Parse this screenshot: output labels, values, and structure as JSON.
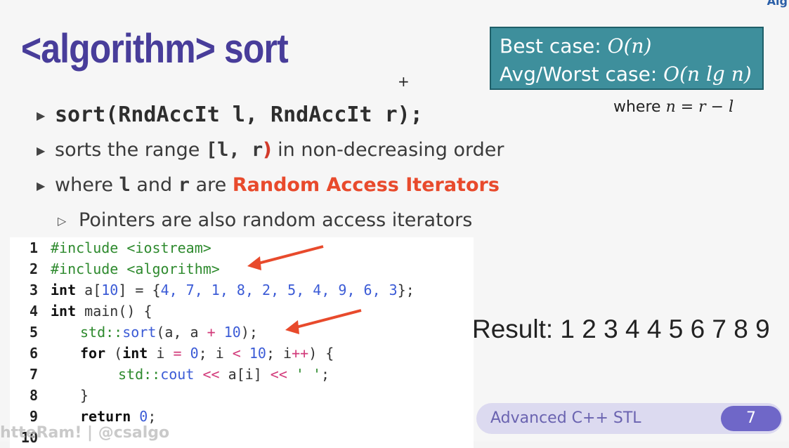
{
  "corner_text": "Alg",
  "title": "<algorithm> sort",
  "complexity": {
    "best_label": "Best case: ",
    "best_value": "O(n)",
    "avg_label": "Avg/Worst case: ",
    "avg_value": "O(n lg n)"
  },
  "where_note": {
    "prefix": "where ",
    "formula": "n = r − l"
  },
  "bullets": {
    "b1": "sort(RndAccIt l, RndAccIt r);",
    "b2_pre": "sorts the range ",
    "b2_open": "[",
    "b2_code": "l, r",
    "b2_close": ")",
    "b2_post": " in non-decreasing order",
    "b3_pre": "where ",
    "b3_l": "l",
    "b3_and": " and ",
    "b3_r": "r",
    "b3_are": " are ",
    "b3_highlight": "Random Access Iterators",
    "b4": "Pointers are also random access iterators"
  },
  "code": {
    "l1": {
      "n": "1",
      "a": "#include <iostream>"
    },
    "l2": {
      "n": "2",
      "a": "#include <algorithm>"
    },
    "l3": {
      "n": "3",
      "kw": "int",
      "v": " a[",
      "n10": "10",
      "rest": "] = {",
      "vals": "4, 7, 1, 8, 2, 5, 4, 9, 6, 3",
      "end": "};"
    },
    "l4": {
      "n": "4",
      "kw": "int",
      "rest": " main() {"
    },
    "l5": {
      "n": "5",
      "ns": "std::",
      "fn": "sort",
      "rest1": "(a, a ",
      "op": "+",
      "sp": " ",
      "num": "10",
      "rest2": ");"
    },
    "l6": {
      "n": "6",
      "kw": "for",
      "p1": " (",
      "kw2": "int",
      "p2": " i ",
      "op1": "=",
      "sp1": " ",
      "z": "0",
      "p3": "; i ",
      "op2": "<",
      "sp2": " ",
      "ten": "10",
      "p4": "; i",
      "op3": "++",
      "p5": ") {"
    },
    "l7": {
      "n": "7",
      "ns": "std::",
      "fn": "cout",
      "sp": " ",
      "op1": "<<",
      "mid": " a[i] ",
      "op2": "<<",
      "sp2": " ",
      "str": "' '",
      "end": ";"
    },
    "l8": {
      "n": "8",
      "a": "}"
    },
    "l9": {
      "n": "9",
      "kw": "return",
      "sp": " ",
      "z": "0",
      "end": ";"
    },
    "l10": {
      "n": "10"
    }
  },
  "result": "Result: 1 2 3 4 4 5 6 7 8 9",
  "footer": {
    "label": "Advanced C++ STL",
    "page": "7"
  },
  "watermark": "htteRam! | @csalgo"
}
